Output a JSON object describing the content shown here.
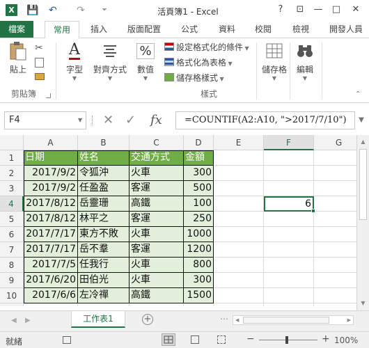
{
  "app": {
    "title": "活頁簿1 - Excel",
    "icon_letter": "X",
    "qat": {
      "save": "💾",
      "undo": "↶",
      "redo": "↷",
      "more": "⏷"
    },
    "window": {
      "help": "?",
      "ribbon_opts": "⊡",
      "minimize": "—",
      "restore": "□",
      "close": "✕"
    }
  },
  "ribbon": {
    "tabs": [
      "檔案",
      "常用",
      "插入",
      "版面配置",
      "公式",
      "資料",
      "校閱",
      "檢視",
      "開發人員"
    ],
    "active_tab": "常用",
    "paste_label": "貼上",
    "clipboard_group": "剪貼簿",
    "font_label": "字型",
    "align_label": "對齊方式",
    "number_label": "數值",
    "percent_symbol": "%",
    "font_symbol": "A",
    "styles": {
      "conditional": "設定格式化的條件",
      "as_table": "格式化為表格",
      "cell_styles": "儲存格樣式",
      "group": "樣式"
    },
    "cells_label": "儲存格",
    "editing_label": "編輯"
  },
  "formula_bar": {
    "name_box": "F4",
    "cancel": "✕",
    "enter": "✓",
    "fx": "fx",
    "formula": "=COUNTIF(A2:A10, \">2017/7/10\")"
  },
  "sheet": {
    "columns": [
      "A",
      "B",
      "C",
      "D",
      "E",
      "F",
      "G"
    ],
    "rows": [
      "1",
      "2",
      "3",
      "4",
      "5",
      "6",
      "7",
      "8",
      "9",
      "10"
    ],
    "selected_column": "F",
    "selected_row": "4",
    "headers": [
      "日期",
      "姓名",
      "交通方式",
      "金額"
    ],
    "data": [
      [
        "2017/9/2",
        "令狐沖",
        "火車",
        "300"
      ],
      [
        "2017/9/2",
        "任盈盈",
        "客運",
        "500"
      ],
      [
        "2017/8/12",
        "岳靈珊",
        "高鐵",
        "100"
      ],
      [
        "2017/8/12",
        "林平之",
        "客運",
        "250"
      ],
      [
        "2017/7/17",
        "東方不敗",
        "火車",
        "1000"
      ],
      [
        "2017/7/17",
        "岳不羣",
        "客運",
        "1200"
      ],
      [
        "2017/7/5",
        "任我行",
        "火車",
        "800"
      ],
      [
        "2017/6/20",
        "田伯光",
        "火車",
        "300"
      ],
      [
        "2017/6/6",
        "左冷禪",
        "高鐵",
        "1500"
      ]
    ],
    "f4_value": "6",
    "colors": {
      "header": "#70ad47",
      "band": "#e2efda",
      "accent": "#217346"
    }
  },
  "sheet_tabs": {
    "active": "工作表1",
    "add": "+",
    "prev": "◀",
    "next": "▶",
    "more": "⋯"
  },
  "status": {
    "ready": "就緒",
    "zoom_minus": "−",
    "zoom_plus": "+",
    "zoom": "100%"
  }
}
